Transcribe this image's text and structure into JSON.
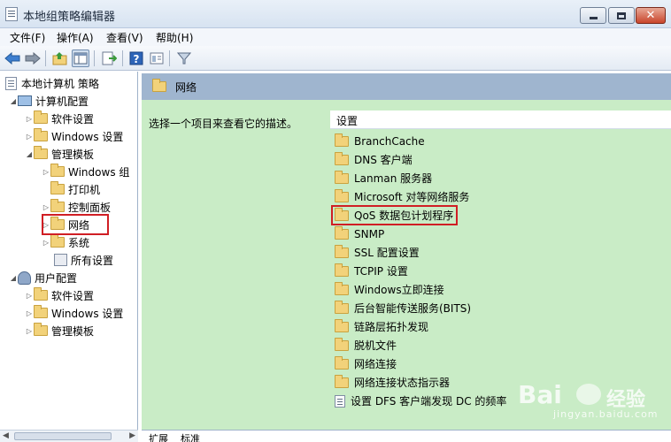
{
  "window": {
    "title": "本地组策略编辑器",
    "close_glyph": "✕"
  },
  "menu": [
    "文件(F)",
    "操作(A)",
    "查看(V)",
    "帮助(H)"
  ],
  "toolbar": {
    "buttons": [
      "back-icon",
      "forward-icon",
      "up-folder-icon",
      "show-hide-tree-icon",
      "export-list-icon",
      "help-icon",
      "properties-icon",
      "filter-icon"
    ]
  },
  "tree": {
    "root": "本地计算机 策略",
    "computer_config": "计算机配置",
    "computer_children": {
      "software": "软件设置",
      "windows": "Windows 设置",
      "admin_templates": "管理模板"
    },
    "admin_children": {
      "windows_components": "Windows 组",
      "printers": "打印机",
      "control_panel": "控制面板",
      "network": "网络",
      "system": "系统",
      "all_settings": "所有设置"
    },
    "user_config": "用户配置",
    "user_children": {
      "software": "软件设置",
      "windows": "Windows 设置",
      "admin_templates": "管理模板"
    }
  },
  "content": {
    "header_title": "网络",
    "description": "选择一个项目来查看它的描述。",
    "column_header": "设置",
    "items": [
      "BranchCache",
      "DNS 客户端",
      "Lanman 服务器",
      "Microsoft 对等网络服务",
      "QoS 数据包计划程序",
      "SNMP",
      "SSL 配置设置",
      "TCPIP 设置",
      "Windows立即连接",
      "后台智能传送服务(BITS)",
      "链路层拓扑发现",
      "脱机文件",
      "网络连接",
      "网络连接状态指示器",
      "设置 DFS 客户端发现 DC 的频率"
    ]
  },
  "tabs": [
    "扩展",
    "标准"
  ],
  "watermark": {
    "brand": "Bai",
    "brand_suffix": "经验",
    "url": "jingyan.baidu.com"
  },
  "colors": {
    "highlight_box": "#d01e24",
    "content_bg": "#c9ecc6",
    "header_bg": "#9fb5cf"
  }
}
